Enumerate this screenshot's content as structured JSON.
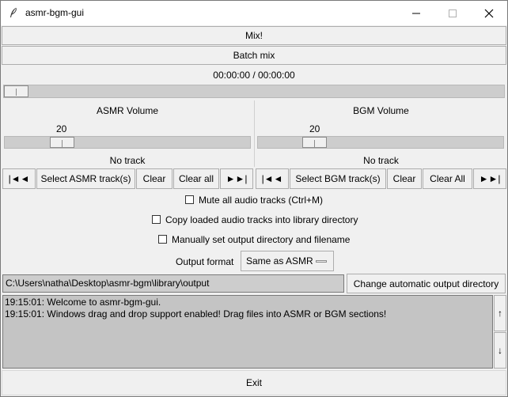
{
  "window": {
    "title": "asmr-bgm-gui",
    "minimize_icon": "minimize-icon",
    "maximize_icon": "maximize-icon",
    "close_icon": "close-icon"
  },
  "toolbar": {
    "mix_label": "Mix!",
    "batch_mix_label": "Batch mix"
  },
  "playback": {
    "time": "00:00:00 / 00:00:00",
    "progress": 0
  },
  "asmr": {
    "title": "ASMR Volume",
    "volume_value": "20",
    "track_status": "No track",
    "prev_label": "|◄◄",
    "select_label": "Select ASMR track(s)",
    "clear_label": "Clear",
    "clear_all_label": "Clear all",
    "next_label": "►►|"
  },
  "bgm": {
    "title": "BGM Volume",
    "volume_value": "20",
    "track_status": "No track",
    "prev_label": "|◄◄",
    "select_label": "Select BGM track(s)",
    "clear_label": "Clear",
    "clear_all_label": "Clear All",
    "next_label": "►►|"
  },
  "options": {
    "mute_label": "Mute all audio tracks (Ctrl+M)",
    "copy_label": "Copy loaded audio tracks into library directory",
    "manual_output_label": "Manually set output directory and filename",
    "output_format_label": "Output format",
    "output_format_value": "Same as ASMR"
  },
  "output": {
    "path": "C:\\Users\\natha\\Desktop\\asmr-bgm\\library\\output",
    "change_dir_label": "Change automatic output directory"
  },
  "log": {
    "lines": [
      "19:15:01: Welcome to asmr-bgm-gui.",
      "19:15:01: Windows drag and drop support enabled! Drag files into ASMR or BGM sections!"
    ],
    "scroll_up": "↑",
    "scroll_down": "↓"
  },
  "footer": {
    "exit_label": "Exit"
  }
}
